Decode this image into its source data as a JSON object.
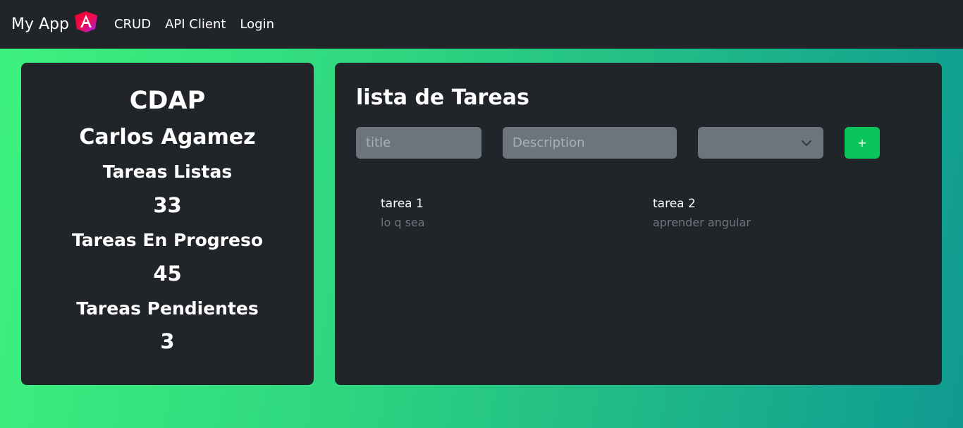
{
  "navbar": {
    "brand": "My App",
    "logo_icon": "angular-logo-icon",
    "links": [
      "CRUD",
      "API Client",
      "Login"
    ]
  },
  "profile": {
    "org": "CDAP",
    "name": "Carlos Agamez",
    "stats": [
      {
        "label": "Tareas Listas",
        "value": "33"
      },
      {
        "label": "Tareas En Progreso",
        "value": "45"
      },
      {
        "label": "Tareas Pendientes",
        "value": "3"
      }
    ]
  },
  "tasks": {
    "title": "lista de Tareas",
    "title_placeholder": "title",
    "description_placeholder": "Description",
    "status_value": "",
    "add_label": "+",
    "items": [
      {
        "title": "tarea 1",
        "description": "lo q sea"
      },
      {
        "title": "tarea 2",
        "description": "aprender angular"
      }
    ]
  },
  "colors": {
    "navbar_bg": "#212529",
    "card_bg": "#212529",
    "input_bg": "#6c757d",
    "add_button": "#0ac65a",
    "gradient_start": "#3ef27f",
    "gradient_end": "#0f9a92"
  }
}
